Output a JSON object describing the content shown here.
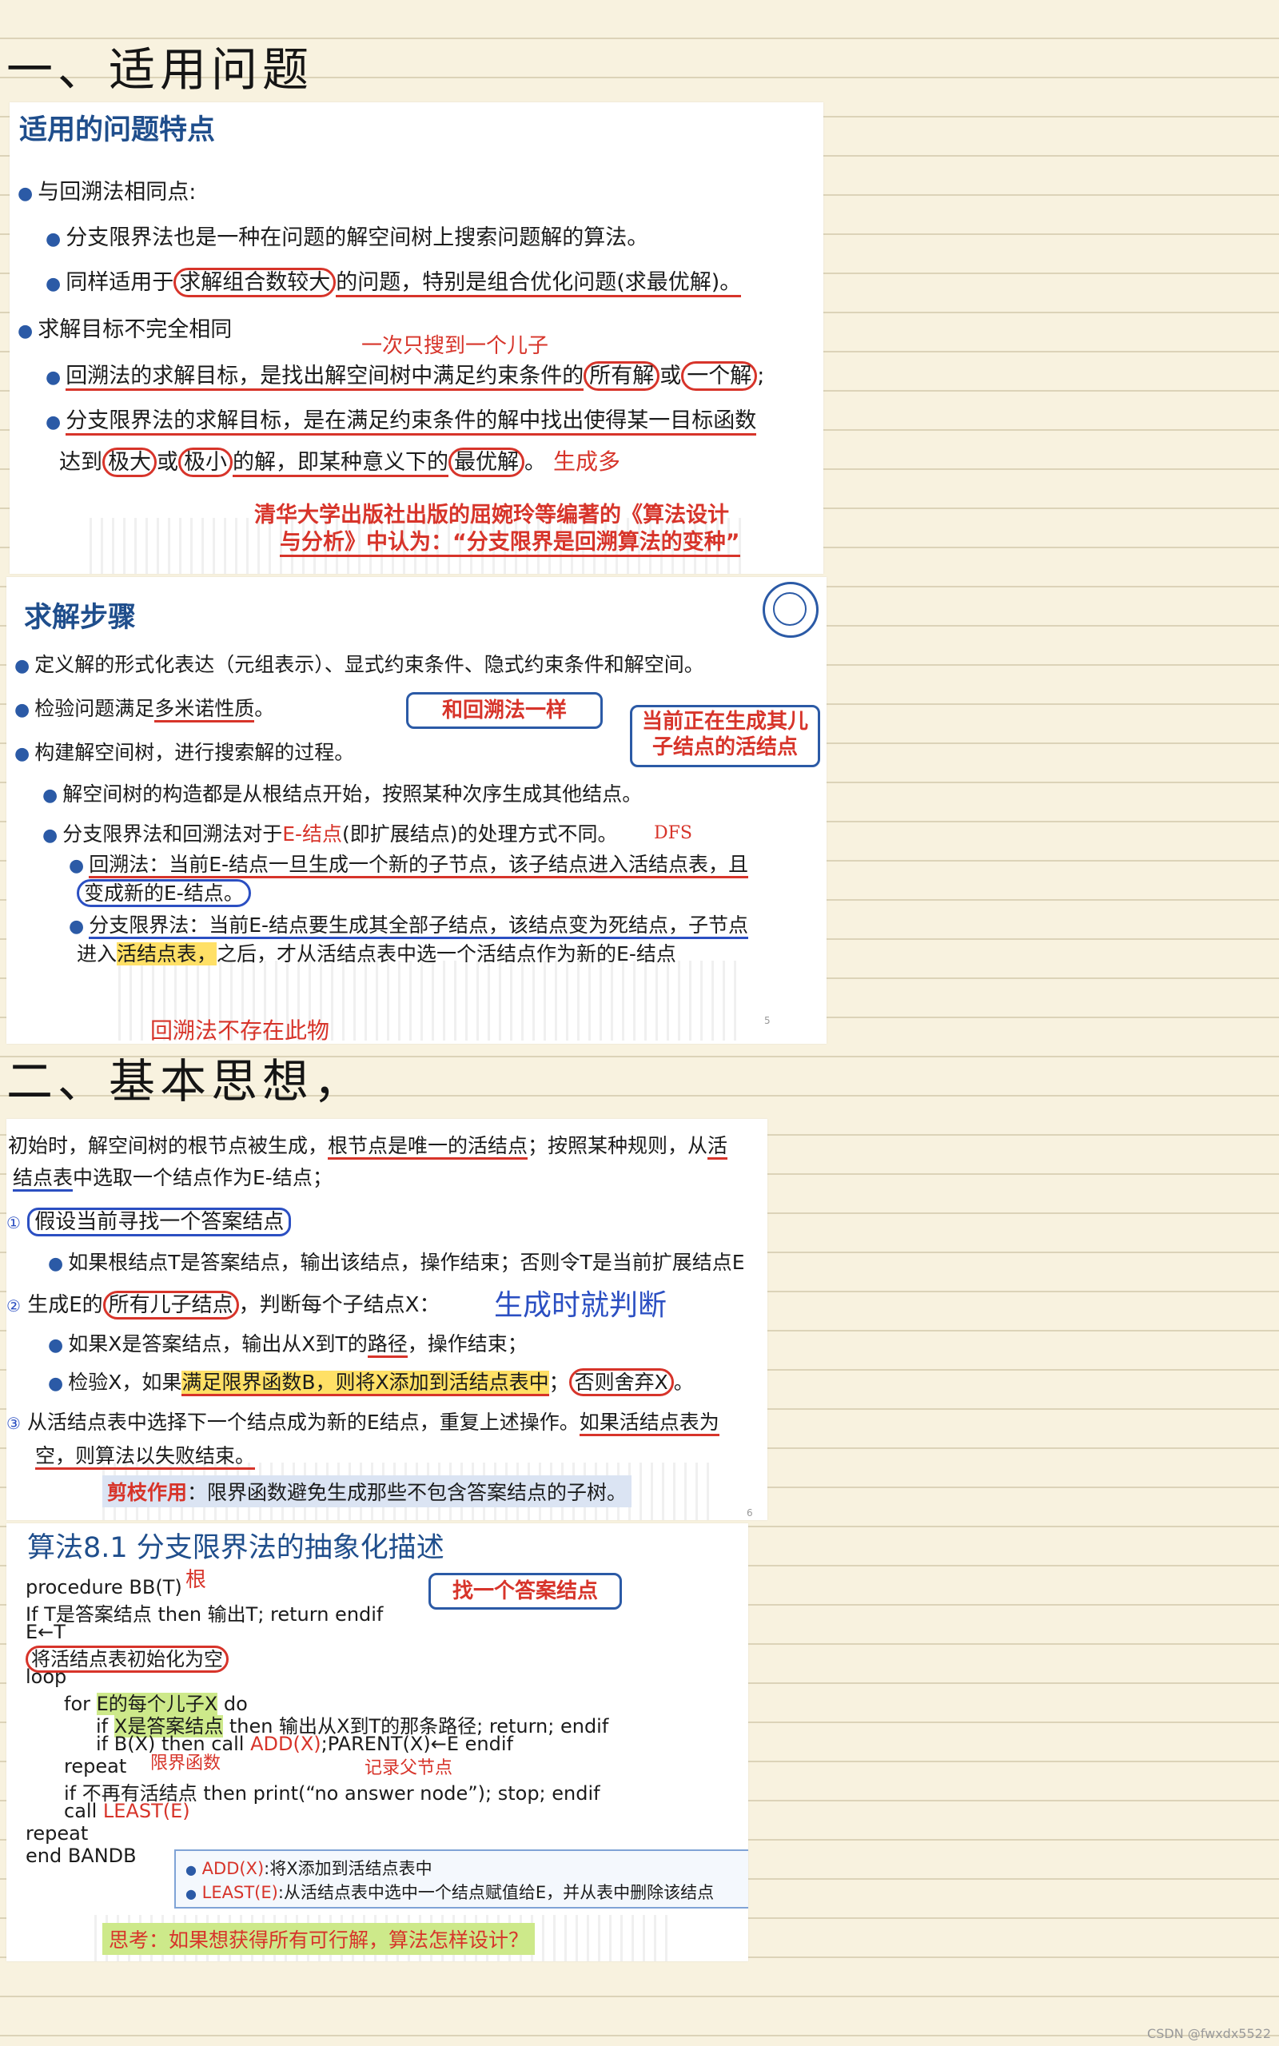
{
  "section1_title": "一、适用问题",
  "slide1": {
    "heading": "适用的问题特点",
    "l1": "与回溯法相同点:",
    "l2": "分支限界法也是一种在问题的解空间树上搜索问题解的算法。",
    "l3a": "同样适用于",
    "l3b": "求解组合数较大",
    "l3c": "的问题，特别是组合优化问题(求最优解)。",
    "l4": "求解目标不完全相同",
    "l5a": "回溯法的求解目标，是找出解空间树中满足约束条件的",
    "l5b": "所有解",
    "l5c": "或",
    "l5d": "一个解",
    "l5e": ";",
    "l6": "分支限界法的求解目标，是在满足约束条件的解中找出使得某一目标函数",
    "l7a": "达到",
    "l7b": "极大",
    "l7c": "或",
    "l7d": "极小",
    "l7e": "的解，即某种意义下的",
    "l7f": "最优解",
    "l7g": "。",
    "note1": "清华大学出版社出版的屈婉玲等编著的《算法设计",
    "note2": "与分析》中认为：“分支限界是回溯算法的变种”",
    "hand1": "一次只搜到一个儿子",
    "hand2": "生成多"
  },
  "slide2": {
    "heading": "求解步骤",
    "l1": "定义解的形式化表达（元组表示）、显式约束条件、隐式约束条件和解空间。",
    "l2a": "检验问题满足",
    "l2b": "多米诺性质",
    "l2c": "。",
    "l3": "构建解空间树，进行搜索解的过程。",
    "l4": "解空间树的构造都是从根结点开始，按照某种次序生成其他结点。",
    "l5a": "分支限界法和回溯法对于",
    "l5b": "E-结点",
    "l5c": "(即扩展结点)的处理方式不同。",
    "l6": "回溯法：当前E-结点一旦生成一个新的子节点，该子结点进入活结点表，且",
    "l7": "变成新的E-结点。",
    "l8": "分支限界法：当前E-结点要生成其全部子结点，该结点变为死结点，子节点",
    "l9a": "进入",
    "l9b": "活结点表，",
    "l9c": "之后，才从活结点表中选一个活结点作为新的E-结点",
    "box1": "和回溯法一样",
    "box2a": "当前正在生成其儿",
    "box2b": "子结点的活结点",
    "hand_dfs": "DFS",
    "hand_bottom": "回溯法不存在此物",
    "page": "5"
  },
  "section2_title": "二、基本思想，",
  "slide3": {
    "l1a": "初始时，解空间树的根节点被生成，",
    "l1b": "根节点是唯一的活结点",
    "l1c": "；按照某种规则，从",
    "l1d": "活",
    "l2a": "结点表",
    "l2b": "中选取一个结点作为E-结点；",
    "n1": "①",
    "l3": "假设当前寻找一个答案结点",
    "l4": "如果根结点T是答案结点，输出该结点，操作结束；否则令T是当前扩展结点E",
    "n2": "②",
    "l5a": "生成E的",
    "l5b": "所有儿子结点",
    "l5c": "，判断每个子结点X：",
    "hand_gen": "生成时就判断",
    "l6a": "如果X是答案结点，输出从X到T的",
    "l6b": "路径",
    "l6c": "，操作结束；",
    "l7a": "检验X，如果",
    "l7b": "满足限界函数B，则将X添加到活结点表中",
    "l7c": "；",
    "l7d": "否则舍弃X",
    "l7e": "。",
    "n3": "③",
    "l8a": "从活结点表中选择下一个结点成为新的E结点，重复上述操作。",
    "l8b": "如果活结点表为",
    "l9": "空，则算法以失败结束。",
    "l10a": "剪枝作用",
    "l10b": "：限界函数避免生成那些不包含答案结点的子树。",
    "page": "6"
  },
  "slide4": {
    "heading": "算法8.1  分支限界法的抽象化描述",
    "box": "找一个答案结点",
    "hand_root": "根",
    "c1": "procedure BB(T)",
    "c2": "If T是答案结点 then 输出T; return endif",
    "c3": "E←T",
    "c4": "将活结点表初始化为空",
    "c5": "loop",
    "c6a": "for ",
    "c6b": "E的每个儿子X",
    "c6c": " do",
    "c7a": "if ",
    "c7b": "X是答案结点",
    "c7c": " then 输出从X到T的那条路径; return; endif",
    "c8a": "if B(X) then call ",
    "c8b": "ADD(X)",
    "c8c": ";PARENT(X)←E endif",
    "c9": "repeat",
    "hand_bound": "限界函数",
    "hand_record": "记录父节点",
    "c10": "if 不再有活结点 then print(“no answer node”); stop; endif",
    "c11a": "call ",
    "c11b": "LEAST(E)",
    "c12": "repeat",
    "c13": "end BANDB",
    "legend1a": "ADD(X)",
    "legend1b": ":将X添加到活结点表中",
    "legend2a": "LEAST(E)",
    "legend2b": ":从活结点表中选中一个结点赋值给E，并从表中删除该结点",
    "think": "思考：如果想获得所有可行解，算法怎样设计？"
  },
  "footer": "CSDN @fwxdx5522"
}
